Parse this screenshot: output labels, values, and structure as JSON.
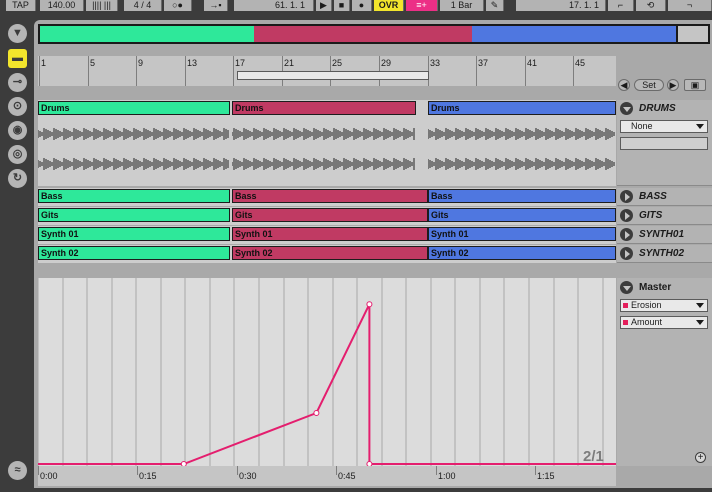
{
  "transport": {
    "tap": "TAP",
    "tempo": "140.00",
    "signature": "4 / 4",
    "position": "61. 1. 1",
    "overdub": "OVR",
    "quantize": "1 Bar",
    "loop_start": "17. 1. 1"
  },
  "ruler": {
    "bars": [
      "1",
      "5",
      "9",
      "13",
      "17",
      "21",
      "25",
      "29",
      "33",
      "37",
      "41",
      "45"
    ],
    "set_label": "Set"
  },
  "tracks": [
    {
      "name": "DRUMS",
      "clips": [
        "Drums",
        "Drums",
        "Drums"
      ],
      "dropdown": "None"
    },
    {
      "name": "BASS",
      "clips": [
        "Bass",
        "Bass",
        "Bass"
      ]
    },
    {
      "name": "GITS",
      "clips": [
        "Gits",
        "Gits",
        "Gits"
      ]
    },
    {
      "name": "SYNTH01",
      "clips": [
        "Synth 01",
        "Synth 01",
        "Synth 01"
      ]
    },
    {
      "name": "SYNTH02",
      "clips": [
        "Synth 02",
        "Synth 02",
        "Synth 02"
      ]
    }
  ],
  "master": {
    "name": "Master",
    "device": "Erosion",
    "parameter": "Amount",
    "automation_points": [
      {
        "time": "0:22",
        "value": 0
      },
      {
        "time": "0:42",
        "value": 0.3
      },
      {
        "time": "0:50",
        "value": 0.94
      },
      {
        "time": "0:50",
        "value": 0
      }
    ]
  },
  "timeline": [
    "0:00",
    "0:15",
    "0:30",
    "0:45",
    "1:00",
    "1:15"
  ],
  "track_count": "2/1",
  "add_label": "+",
  "colors": {
    "green": "#2ee89a",
    "red": "#c03a63",
    "blue": "#4f77e0",
    "automation": "#e41e6e",
    "overdub": "#f2e52c"
  },
  "icons": [
    "triangle-down-icon",
    "clip-view-icon",
    "plug-icon",
    "io-icon",
    "send-icon",
    "return-icon",
    "mixer-icon",
    "waveform-icon"
  ]
}
